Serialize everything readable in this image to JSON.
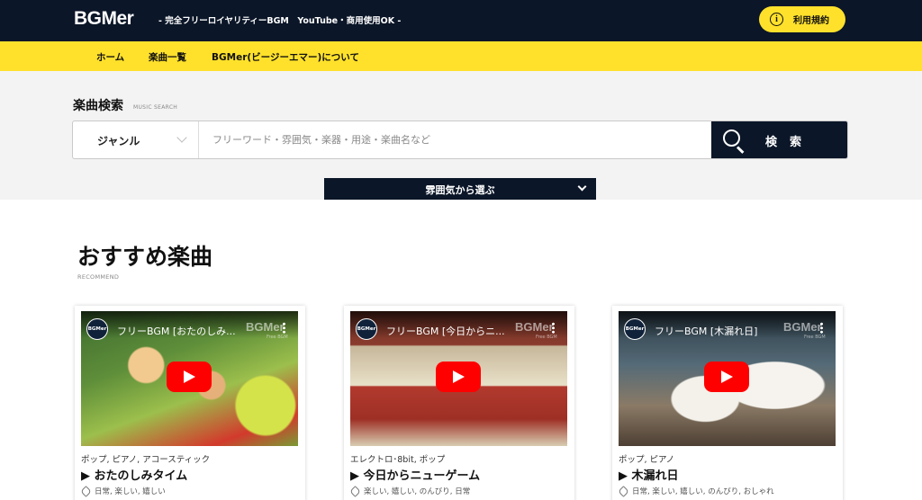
{
  "header": {
    "logo": "BGMer",
    "tagline": "- 完全フリーロイヤリティーBGM　YouTube・商用使用OK -",
    "terms_icon": "i",
    "terms_label": "利用規約"
  },
  "nav": {
    "items": [
      {
        "label": "ホーム"
      },
      {
        "label": "楽曲一覧"
      },
      {
        "label": "BGMer(ビージーエマー)について"
      }
    ]
  },
  "search": {
    "title": "楽曲検索",
    "subtitle": "MUSIC SEARCH",
    "genre_label": "ジャンル",
    "placeholder": "フリーワード・雰囲気・楽器・用途・楽曲名など",
    "button_label": "検索",
    "mood_label": "雰囲気から選ぶ"
  },
  "recommend": {
    "title": "おすすめ楽曲",
    "subtitle": "RECOMMEND",
    "cards": [
      {
        "channel": "BGMer",
        "video_title": "フリーBGM [おたのしみ...",
        "watermark": "BGMer",
        "watermark_sub": "Free BGM",
        "genres": "ポップ, ピアノ, アコースティック",
        "track": "▶ おたのしみタイム",
        "tags": "日常, 楽しい, 嬉しい"
      },
      {
        "channel": "BGMer",
        "video_title": "フリーBGM [今日からニ...",
        "watermark": "BGMer",
        "watermark_sub": "Free BGM",
        "genres": "エレクトロ･8bit, ポップ",
        "track": "▶ 今日からニューゲーム",
        "tags": "楽しい, 嬉しい, のんびり, 日常"
      },
      {
        "channel": "BGMer",
        "video_title": "フリーBGM [木漏れ日]",
        "watermark": "BGMer",
        "watermark_sub": "Free BGM",
        "genres": "ポップ, ピアノ",
        "track": "▶ 木漏れ日",
        "tags": "日常, 楽しい, 嬉しい, のんびり, おしゃれ"
      }
    ]
  }
}
